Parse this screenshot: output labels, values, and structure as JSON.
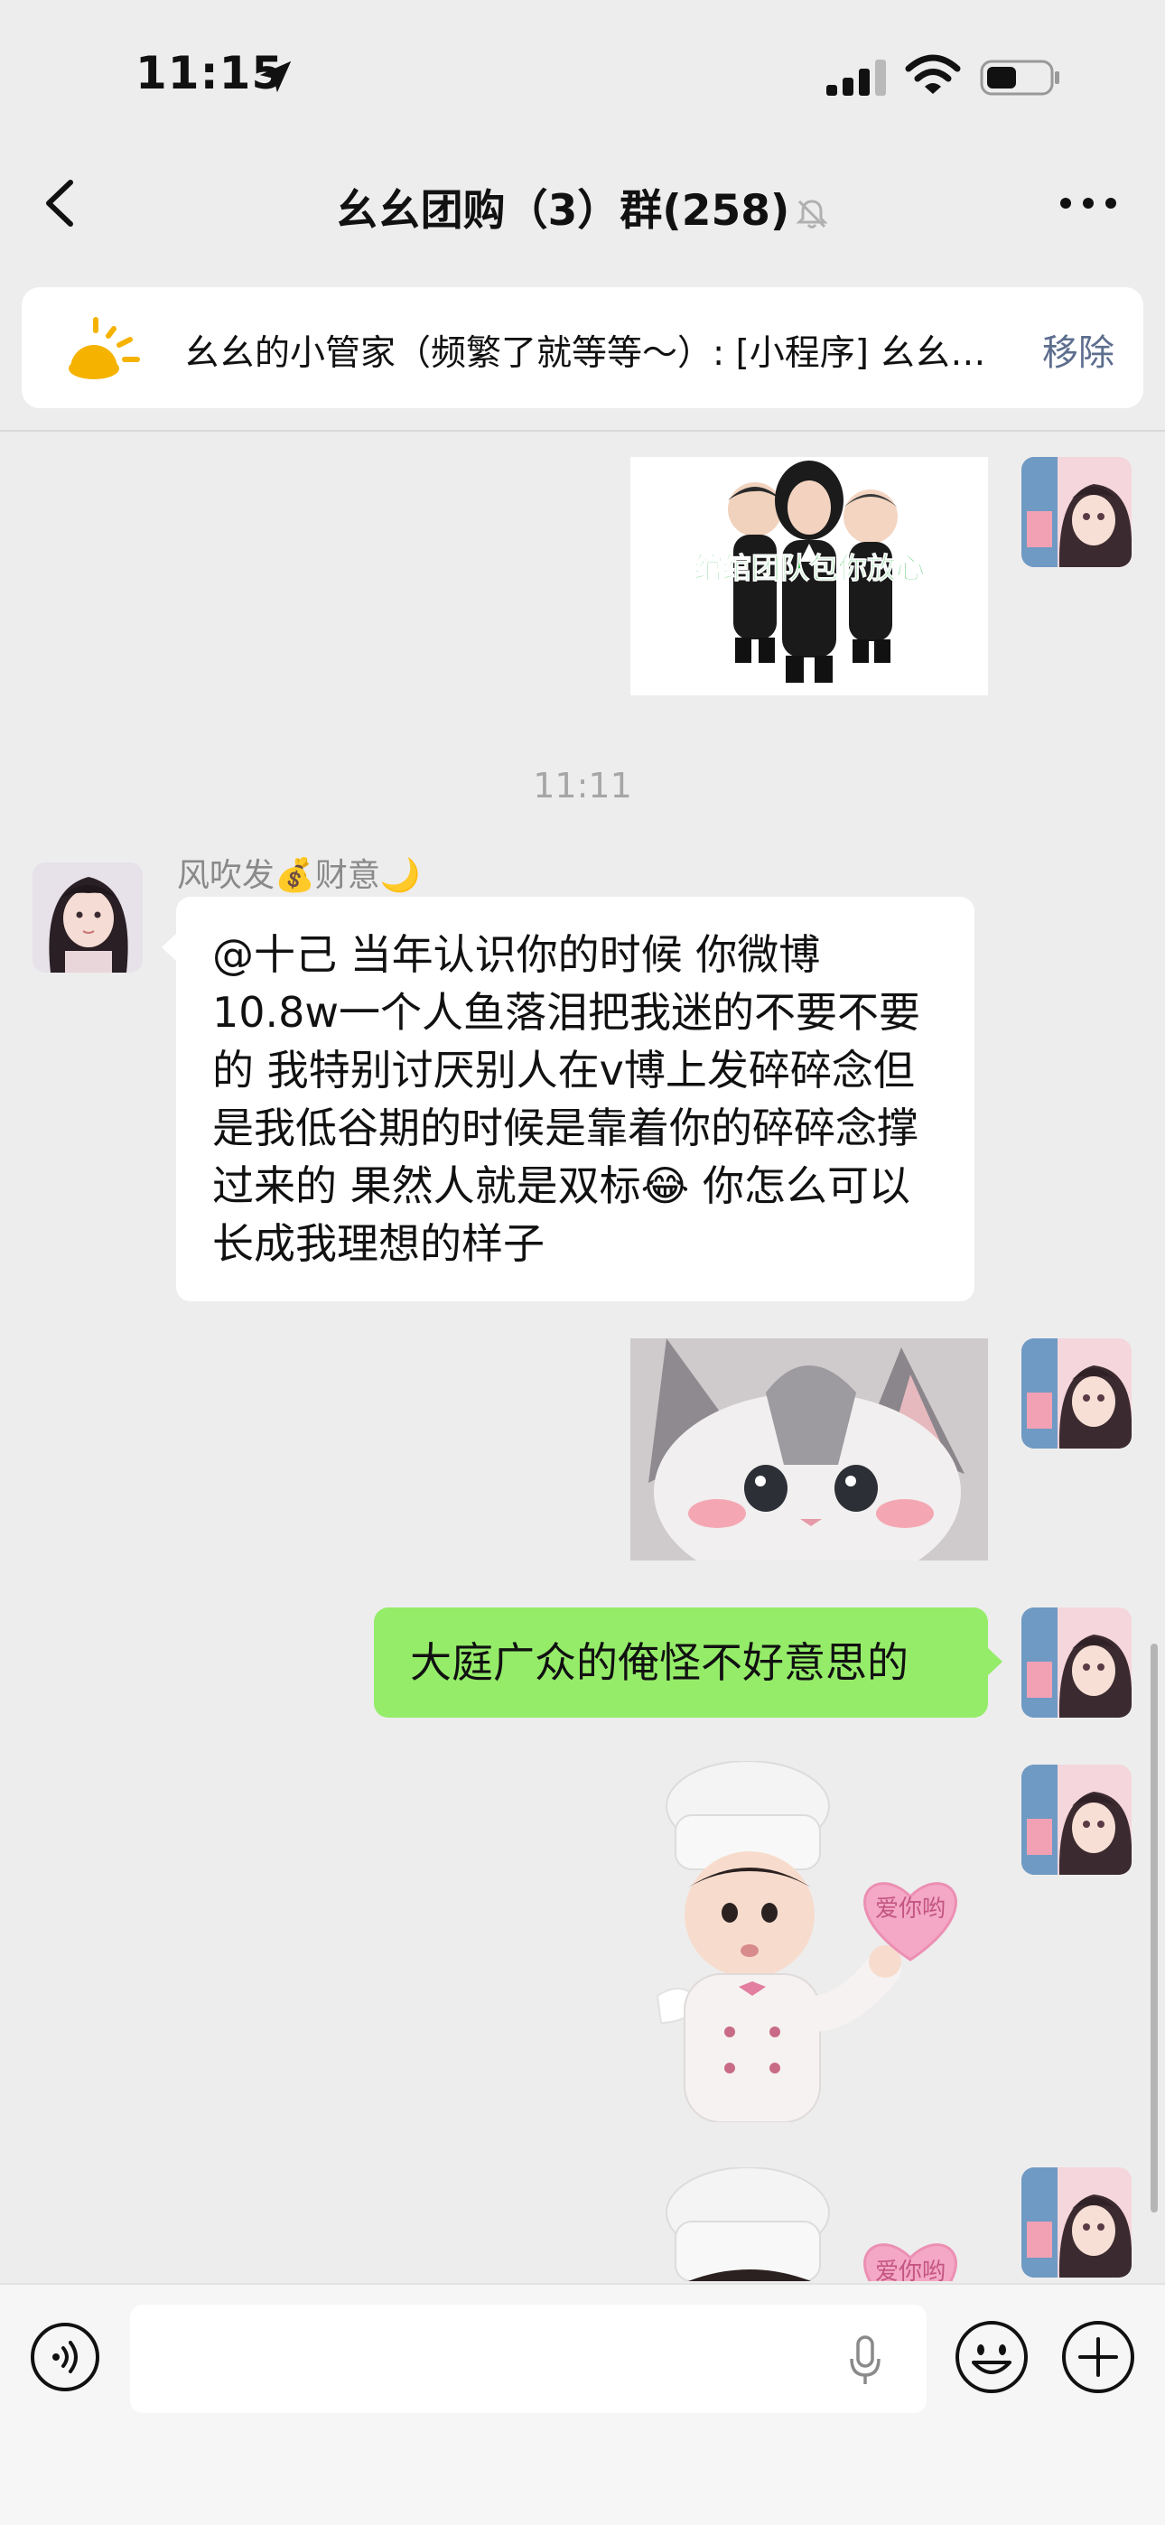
{
  "status_bar": {
    "time": "11:15"
  },
  "nav": {
    "title": "幺幺团购（3）群(258)"
  },
  "notice": {
    "text": "幺幺的小管家（频繁了就等等～）: [小程序] 幺幺…",
    "remove_label": "移除"
  },
  "stickers": {
    "team_caption": "绾绾团队包你放心",
    "heart_text_1": "爱你哟",
    "heart_text_2": "爱你哟"
  },
  "messages": {
    "timestamp": "11:11",
    "sender_name": "风吹发💰财意🌙",
    "left_text": "@十己 当年认识你的时候 你微博10.8w一个人鱼落泪把我迷的不要不要的 我特别讨厌别人在v博上发碎碎念但是我低谷期的时候是靠着你的碎碎念撑过来的  果然人就是双标😂 你怎么可以长成我理想的样子",
    "right_text": "大庭广众的俺怪不好意思的"
  },
  "colors": {
    "background": "#ededed",
    "bubble_right": "#95ec69",
    "bubble_left": "#ffffff",
    "link_blue": "#5d6e8e"
  },
  "icons": [
    "location-arrow-icon",
    "signal-icon",
    "wifi-icon",
    "battery-icon",
    "back-chevron-icon",
    "mute-bell-icon",
    "more-dots-icon",
    "sun-icon",
    "voice-icon",
    "microphone-icon",
    "emoji-icon",
    "plus-icon"
  ]
}
